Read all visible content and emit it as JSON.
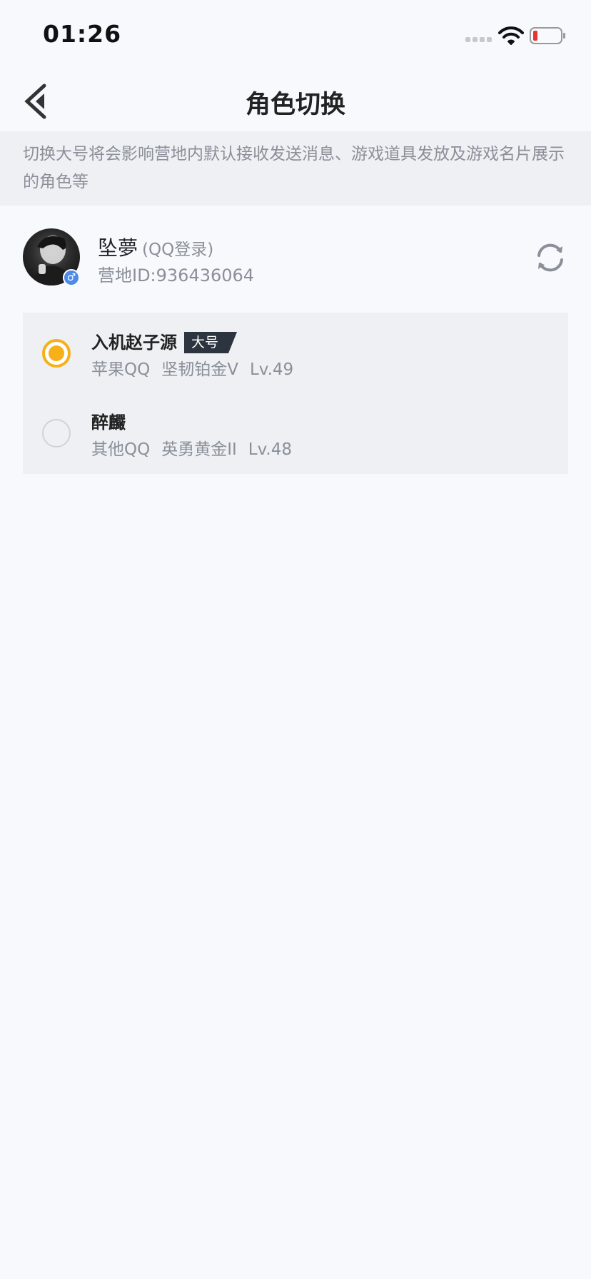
{
  "status_bar": {
    "time": "01:26"
  },
  "nav": {
    "title": "角色切换"
  },
  "notice": {
    "text": "切换大号将会影响营地内默认接收发送消息、游戏道具发放及游戏名片展示的角色等"
  },
  "user": {
    "name": "坠夢",
    "login_type": "(QQ登录)",
    "camp_id": "营地ID:936436064",
    "gender_symbol": "♂"
  },
  "roles": [
    {
      "name": "入机赵子源",
      "badge": "大号",
      "platform": "苹果QQ",
      "rank": "坚韧铂金V",
      "level": "Lv.49",
      "selected": true
    },
    {
      "name": "醉麣",
      "badge": "",
      "platform": "其他QQ",
      "rank": "英勇黄金II",
      "level": "Lv.48",
      "selected": false
    }
  ],
  "colors": {
    "accent": "#f6b018",
    "background": "#f7f9fd",
    "panel": "#eef0f3",
    "muted_text": "#8a8f99",
    "badge_bg": "#2c3440",
    "gender_badge": "#4d8be8"
  },
  "icons": {
    "back": "chevron-left-icon",
    "refresh": "refresh-icon",
    "wifi": "wifi-icon",
    "battery": "battery-low-icon",
    "signal": "signal-icon"
  }
}
